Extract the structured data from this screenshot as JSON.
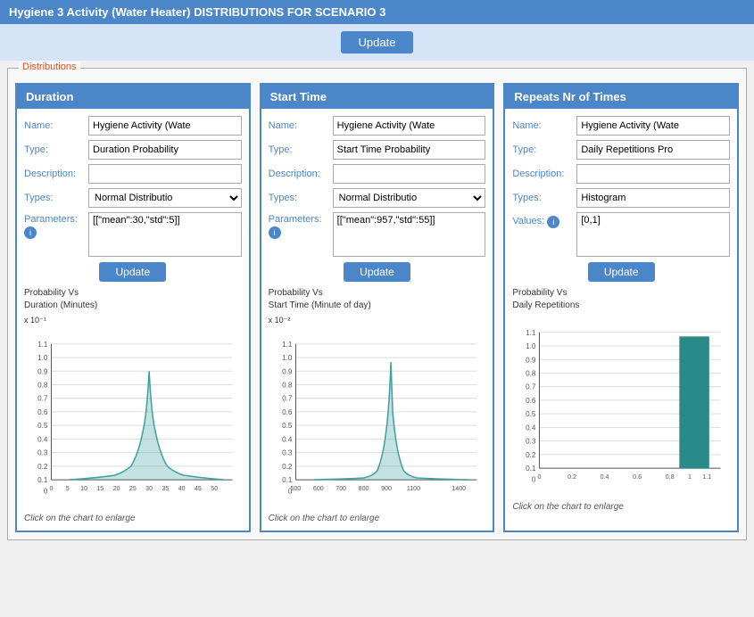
{
  "page": {
    "title": "Hygiene 3 Activity (Water Heater) DISTRIBUTIONS FOR SCENARIO 3"
  },
  "top_bar": {
    "update_button": "Update"
  },
  "distributions_label": "Distributions",
  "cards": [
    {
      "id": "duration",
      "header": "Duration",
      "name_label": "Name:",
      "name_value": "Hygiene Activity (Wate",
      "type_label": "Type:",
      "type_value": "Duration Probability",
      "desc_label": "Description:",
      "desc_value": "",
      "types_label": "Types:",
      "types_value": "Normal Distributio",
      "params_label": "Parameters:",
      "params_value": "[[\"mean\":30,\"std\":5]]",
      "update_button": "Update",
      "chart_title_line1": "Probability Vs",
      "chart_title_line2": "Duration (Minutes)",
      "chart_exponent": "x 10⁻¹",
      "x_labels": [
        "0",
        "5",
        "10",
        "15",
        "20",
        "25",
        "30",
        "35",
        "40",
        "45",
        "50"
      ],
      "y_labels": [
        "0",
        "0.1",
        "0.2",
        "0.3",
        "0.4",
        "0.5",
        "0.6",
        "0.7",
        "0.8",
        "0.9",
        "1.0",
        "1.1"
      ],
      "click_label": "Click on the chart to enlarge",
      "chart_type": "bell",
      "bell_center": 0.6,
      "bell_width": 0.18
    },
    {
      "id": "start_time",
      "header": "Start Time",
      "name_label": "Name:",
      "name_value": "Hygiene Activity (Wate",
      "type_label": "Type:",
      "type_value": "Start Time Probability",
      "desc_label": "Description:",
      "desc_value": "",
      "types_label": "Types:",
      "types_value": "Normal Distributio",
      "params_label": "Parameters:",
      "params_value": "[[\"mean\":957,\"std\":55]]",
      "update_button": "Update",
      "chart_title_line1": "Probability Vs",
      "chart_title_line2": "Start Time (Minute of day)",
      "chart_exponent": "x 10⁻²",
      "x_labels": [
        "500",
        "600",
        "700",
        "800",
        "900",
        "",
        "1100",
        "",
        "1400"
      ],
      "y_labels": [
        "0",
        "0.1",
        "0.2",
        "0.3",
        "0.4",
        "0.5",
        "0.6",
        "0.7",
        "0.8",
        "0.9",
        "1.0",
        "1.1"
      ],
      "click_label": "Click on the chart to enlarge",
      "chart_type": "bell",
      "bell_center": 0.62,
      "bell_width": 0.1
    },
    {
      "id": "repeats",
      "header": "Repeats Nr of Times",
      "name_label": "Name:",
      "name_value": "Hygiene Activity (Wate",
      "type_label": "Type:",
      "type_value": "Daily Repetitions Pro",
      "desc_label": "Description:",
      "desc_value": "",
      "types_label": "Types:",
      "types_value": "Histogram",
      "values_label": "Values:",
      "values_value": "[0,1]",
      "update_button": "Update",
      "chart_title_line1": "Probability Vs",
      "chart_title_line2": "Daily Repetitions",
      "x_labels": [
        "0",
        "0.2",
        "0.4",
        "0.6",
        "0.8",
        "1",
        "1.1"
      ],
      "y_labels": [
        "0",
        "0.1",
        "0.2",
        "0.3",
        "0.4",
        "0.5",
        "0.6",
        "0.7",
        "0.8",
        "0.9",
        "1.0",
        "1.1"
      ],
      "click_label": "Click on the chart to enlarge",
      "chart_type": "histogram",
      "bar_x": 0.72,
      "bar_height": 0.95
    }
  ]
}
